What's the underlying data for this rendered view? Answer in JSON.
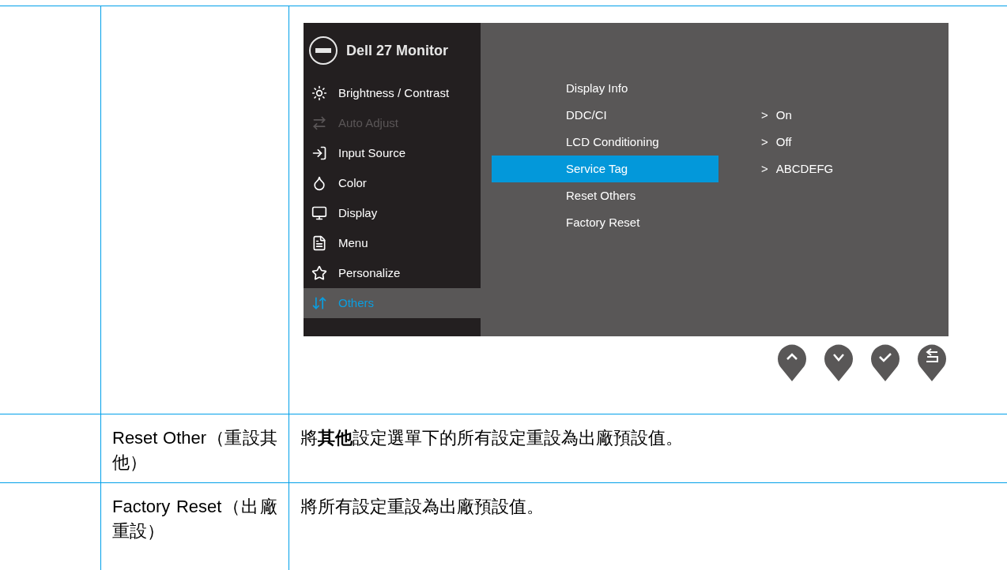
{
  "osd": {
    "title": "Dell 27 Monitor",
    "menu": [
      {
        "label": "Brightness / Contrast",
        "selected": false,
        "disabled": false
      },
      {
        "label": "Auto Adjust",
        "selected": false,
        "disabled": true
      },
      {
        "label": "Input Source",
        "selected": false,
        "disabled": false
      },
      {
        "label": "Color",
        "selected": false,
        "disabled": false
      },
      {
        "label": "Display",
        "selected": false,
        "disabled": false
      },
      {
        "label": "Menu",
        "selected": false,
        "disabled": false
      },
      {
        "label": "Personalize",
        "selected": false,
        "disabled": false
      },
      {
        "label": "Others",
        "selected": true,
        "disabled": false
      }
    ],
    "submenu": [
      {
        "label": "Display Info",
        "selected": false
      },
      {
        "label": "DDC/CI",
        "selected": false,
        "value": "On"
      },
      {
        "label": "LCD Conditioning",
        "selected": false,
        "value": "Off"
      },
      {
        "label": "Service Tag",
        "selected": true,
        "value": "ABCDEFG"
      },
      {
        "label": "Reset Others",
        "selected": false
      },
      {
        "label": "Factory Reset",
        "selected": false
      }
    ],
    "value_marker": ">"
  },
  "rows": [
    {
      "name": "Reset Other（重設其他）",
      "description": "將**其他**設定選單下的所有設定重設為出廠預設值。"
    },
    {
      "name": "Factory Reset（出廠重設）",
      "description": "將所有設定重設為出廠預設值。"
    }
  ]
}
